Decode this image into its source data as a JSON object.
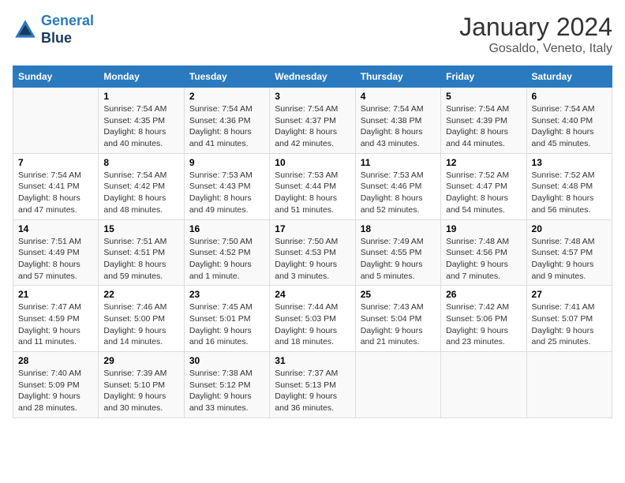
{
  "logo": {
    "line1": "General",
    "line2": "Blue"
  },
  "title": "January 2024",
  "subtitle": "Gosaldo, Veneto, Italy",
  "days_of_week": [
    "Sunday",
    "Monday",
    "Tuesday",
    "Wednesday",
    "Thursday",
    "Friday",
    "Saturday"
  ],
  "weeks": [
    [
      {
        "day": "",
        "sunrise": "",
        "sunset": "",
        "daylight": ""
      },
      {
        "day": "1",
        "sunrise": "Sunrise: 7:54 AM",
        "sunset": "Sunset: 4:35 PM",
        "daylight": "Daylight: 8 hours and 40 minutes."
      },
      {
        "day": "2",
        "sunrise": "Sunrise: 7:54 AM",
        "sunset": "Sunset: 4:36 PM",
        "daylight": "Daylight: 8 hours and 41 minutes."
      },
      {
        "day": "3",
        "sunrise": "Sunrise: 7:54 AM",
        "sunset": "Sunset: 4:37 PM",
        "daylight": "Daylight: 8 hours and 42 minutes."
      },
      {
        "day": "4",
        "sunrise": "Sunrise: 7:54 AM",
        "sunset": "Sunset: 4:38 PM",
        "daylight": "Daylight: 8 hours and 43 minutes."
      },
      {
        "day": "5",
        "sunrise": "Sunrise: 7:54 AM",
        "sunset": "Sunset: 4:39 PM",
        "daylight": "Daylight: 8 hours and 44 minutes."
      },
      {
        "day": "6",
        "sunrise": "Sunrise: 7:54 AM",
        "sunset": "Sunset: 4:40 PM",
        "daylight": "Daylight: 8 hours and 45 minutes."
      }
    ],
    [
      {
        "day": "7",
        "sunrise": "Sunrise: 7:54 AM",
        "sunset": "Sunset: 4:41 PM",
        "daylight": "Daylight: 8 hours and 47 minutes."
      },
      {
        "day": "8",
        "sunrise": "Sunrise: 7:54 AM",
        "sunset": "Sunset: 4:42 PM",
        "daylight": "Daylight: 8 hours and 48 minutes."
      },
      {
        "day": "9",
        "sunrise": "Sunrise: 7:53 AM",
        "sunset": "Sunset: 4:43 PM",
        "daylight": "Daylight: 8 hours and 49 minutes."
      },
      {
        "day": "10",
        "sunrise": "Sunrise: 7:53 AM",
        "sunset": "Sunset: 4:44 PM",
        "daylight": "Daylight: 8 hours and 51 minutes."
      },
      {
        "day": "11",
        "sunrise": "Sunrise: 7:53 AM",
        "sunset": "Sunset: 4:46 PM",
        "daylight": "Daylight: 8 hours and 52 minutes."
      },
      {
        "day": "12",
        "sunrise": "Sunrise: 7:52 AM",
        "sunset": "Sunset: 4:47 PM",
        "daylight": "Daylight: 8 hours and 54 minutes."
      },
      {
        "day": "13",
        "sunrise": "Sunrise: 7:52 AM",
        "sunset": "Sunset: 4:48 PM",
        "daylight": "Daylight: 8 hours and 56 minutes."
      }
    ],
    [
      {
        "day": "14",
        "sunrise": "Sunrise: 7:51 AM",
        "sunset": "Sunset: 4:49 PM",
        "daylight": "Daylight: 8 hours and 57 minutes."
      },
      {
        "day": "15",
        "sunrise": "Sunrise: 7:51 AM",
        "sunset": "Sunset: 4:51 PM",
        "daylight": "Daylight: 8 hours and 59 minutes."
      },
      {
        "day": "16",
        "sunrise": "Sunrise: 7:50 AM",
        "sunset": "Sunset: 4:52 PM",
        "daylight": "Daylight: 9 hours and 1 minute."
      },
      {
        "day": "17",
        "sunrise": "Sunrise: 7:50 AM",
        "sunset": "Sunset: 4:53 PM",
        "daylight": "Daylight: 9 hours and 3 minutes."
      },
      {
        "day": "18",
        "sunrise": "Sunrise: 7:49 AM",
        "sunset": "Sunset: 4:55 PM",
        "daylight": "Daylight: 9 hours and 5 minutes."
      },
      {
        "day": "19",
        "sunrise": "Sunrise: 7:48 AM",
        "sunset": "Sunset: 4:56 PM",
        "daylight": "Daylight: 9 hours and 7 minutes."
      },
      {
        "day": "20",
        "sunrise": "Sunrise: 7:48 AM",
        "sunset": "Sunset: 4:57 PM",
        "daylight": "Daylight: 9 hours and 9 minutes."
      }
    ],
    [
      {
        "day": "21",
        "sunrise": "Sunrise: 7:47 AM",
        "sunset": "Sunset: 4:59 PM",
        "daylight": "Daylight: 9 hours and 11 minutes."
      },
      {
        "day": "22",
        "sunrise": "Sunrise: 7:46 AM",
        "sunset": "Sunset: 5:00 PM",
        "daylight": "Daylight: 9 hours and 14 minutes."
      },
      {
        "day": "23",
        "sunrise": "Sunrise: 7:45 AM",
        "sunset": "Sunset: 5:01 PM",
        "daylight": "Daylight: 9 hours and 16 minutes."
      },
      {
        "day": "24",
        "sunrise": "Sunrise: 7:44 AM",
        "sunset": "Sunset: 5:03 PM",
        "daylight": "Daylight: 9 hours and 18 minutes."
      },
      {
        "day": "25",
        "sunrise": "Sunrise: 7:43 AM",
        "sunset": "Sunset: 5:04 PM",
        "daylight": "Daylight: 9 hours and 21 minutes."
      },
      {
        "day": "26",
        "sunrise": "Sunrise: 7:42 AM",
        "sunset": "Sunset: 5:06 PM",
        "daylight": "Daylight: 9 hours and 23 minutes."
      },
      {
        "day": "27",
        "sunrise": "Sunrise: 7:41 AM",
        "sunset": "Sunset: 5:07 PM",
        "daylight": "Daylight: 9 hours and 25 minutes."
      }
    ],
    [
      {
        "day": "28",
        "sunrise": "Sunrise: 7:40 AM",
        "sunset": "Sunset: 5:09 PM",
        "daylight": "Daylight: 9 hours and 28 minutes."
      },
      {
        "day": "29",
        "sunrise": "Sunrise: 7:39 AM",
        "sunset": "Sunset: 5:10 PM",
        "daylight": "Daylight: 9 hours and 30 minutes."
      },
      {
        "day": "30",
        "sunrise": "Sunrise: 7:38 AM",
        "sunset": "Sunset: 5:12 PM",
        "daylight": "Daylight: 9 hours and 33 minutes."
      },
      {
        "day": "31",
        "sunrise": "Sunrise: 7:37 AM",
        "sunset": "Sunset: 5:13 PM",
        "daylight": "Daylight: 9 hours and 36 minutes."
      },
      {
        "day": "",
        "sunrise": "",
        "sunset": "",
        "daylight": ""
      },
      {
        "day": "",
        "sunrise": "",
        "sunset": "",
        "daylight": ""
      },
      {
        "day": "",
        "sunrise": "",
        "sunset": "",
        "daylight": ""
      }
    ]
  ]
}
